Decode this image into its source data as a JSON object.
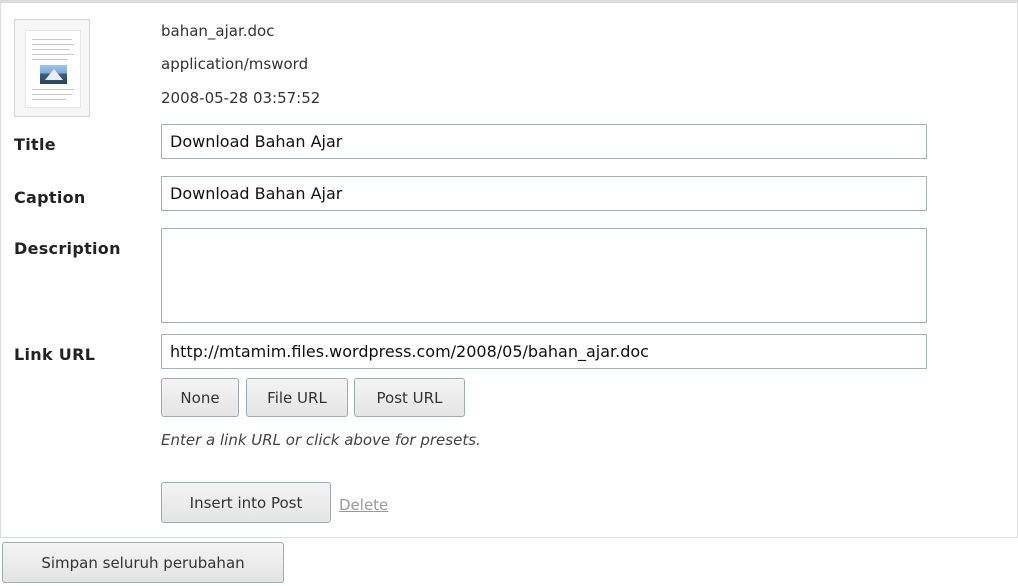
{
  "attachment": {
    "thumbnail_icon": "word-document-icon",
    "filename": "bahan_ajar.doc",
    "mime_type": "application/msword",
    "date": "2008-05-28 03:57:52"
  },
  "fields": {
    "title_label": "Title",
    "title_value": "Download Bahan Ajar",
    "caption_label": "Caption",
    "caption_value": "Download Bahan Ajar",
    "description_label": "Description",
    "description_value": "",
    "link_url_label": "Link URL",
    "link_url_value": "http://mtamim.files.wordpress.com/2008/05/bahan_ajar.doc"
  },
  "link_buttons": {
    "none": "None",
    "file_url": "File URL",
    "post_url": "Post URL"
  },
  "hint": "Enter a link URL or click above for presets.",
  "actions": {
    "insert": "Insert into Post",
    "delete": "Delete",
    "save_all": "Simpan seluruh perubahan"
  },
  "colors": {
    "field_border": "#9fb3c3",
    "panel_border": "#dcdcdc",
    "delete_link": "#9a9a9a"
  }
}
